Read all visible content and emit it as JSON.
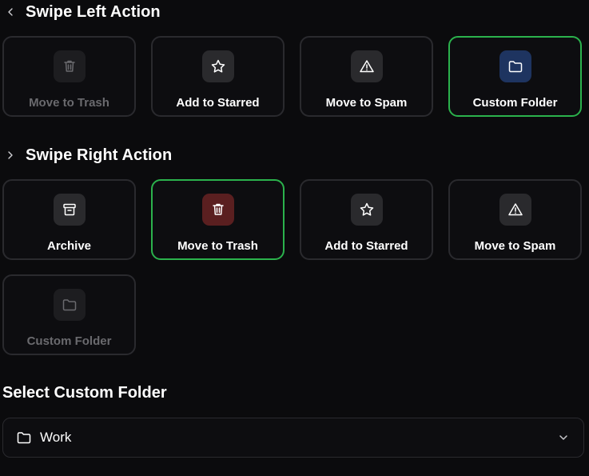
{
  "left": {
    "title": "Swipe Left Action",
    "chevron_icon": "chevron-left-icon",
    "options": [
      {
        "label": "Move to Trash",
        "icon": "trash-icon",
        "state": "disabled"
      },
      {
        "label": "Add to Starred",
        "icon": "star-icon",
        "state": "normal"
      },
      {
        "label": "Move to Spam",
        "icon": "alert-icon",
        "state": "normal"
      },
      {
        "label": "Custom Folder",
        "icon": "folder-icon",
        "state": "selected",
        "icon_bg": "#1e3460"
      }
    ]
  },
  "right": {
    "title": "Swipe Right Action",
    "chevron_icon": "chevron-right-icon",
    "options": [
      {
        "label": "Archive",
        "icon": "archive-icon",
        "state": "normal"
      },
      {
        "label": "Move to Trash",
        "icon": "trash-icon",
        "state": "selected",
        "icon_bg": "#5a1f20"
      },
      {
        "label": "Add to Starred",
        "icon": "star-icon",
        "state": "normal"
      },
      {
        "label": "Move to Spam",
        "icon": "alert-icon",
        "state": "normal"
      },
      {
        "label": "Custom Folder",
        "icon": "folder-icon",
        "state": "disabled"
      }
    ]
  },
  "custom_folder": {
    "label": "Select Custom Folder",
    "value": "Work"
  },
  "colors": {
    "background": "#0b0b0d",
    "selected_border": "#2bb24c",
    "card_border": "#2a2a2e",
    "disabled_text": "#6a6a6e"
  }
}
